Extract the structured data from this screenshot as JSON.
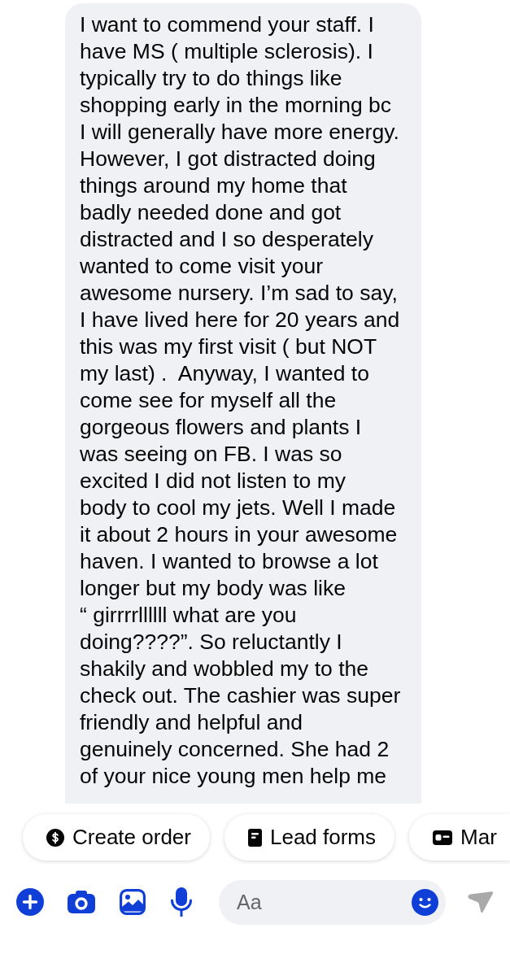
{
  "message": {
    "text": "I want to commend your staff. I\nhave MS ( multiple sclerosis). I\ntypically try to do things like\nshopping early in the morning bc\nI will generally have more energy.\nHowever, I got distracted doing\nthings around my home that\nbadly needed done and got\ndistracted and I so desperately\nwanted to come visit your\nawesome nursery. I’m sad to say,\nI have lived here for 20 years and\nthis was my first visit ( but NOT\nmy last) .  Anyway, I wanted to\ncome see for myself all the\ngorgeous flowers and plants I\nwas seeing on FB. I was so\nexcited I did not listen to my\nbody to cool my jets. Well I made\nit about 2 hours in your awesome\nhaven. I wanted to browse a lot\nlonger but my body was like\n“ girrrrllllll what are you\ndoing????”. So reluctantly I\nshakily and wobbled my to the\ncheck out. The cashier was super\nfriendly and helpful and\ngenuinely concerned. She had 2\nof your nice young men help me"
  },
  "quick_actions": [
    {
      "kind": "dollar",
      "label": "Create order"
    },
    {
      "kind": "form",
      "label": "Lead forms"
    },
    {
      "kind": "card",
      "label": "Mar"
    }
  ],
  "composer": {
    "tools": [
      {
        "kind": "plus"
      },
      {
        "kind": "camera"
      },
      {
        "kind": "image"
      },
      {
        "kind": "mic"
      }
    ],
    "placeholder": "Aa",
    "send": {
      "disabled": true
    }
  }
}
